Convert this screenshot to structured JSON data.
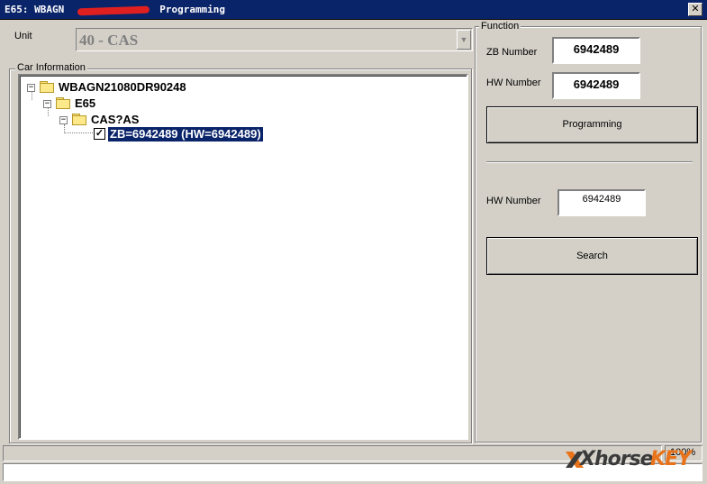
{
  "window": {
    "title_prefix": "E65: WBAGN",
    "title_suffix": "Programming",
    "close_glyph": "✕"
  },
  "unit": {
    "label": "Unit",
    "selected": "40 - CAS",
    "arrow_glyph": "▼"
  },
  "car_info": {
    "legend": "Car Information",
    "tree": [
      {
        "label": "WBAGN21080DR90248",
        "expander": "−"
      },
      {
        "label": "E65",
        "expander": "−"
      },
      {
        "label": "CAS?AS",
        "expander": "−"
      },
      {
        "label": "ZB=6942489 (HW=6942489)",
        "checked": "✓"
      }
    ]
  },
  "function": {
    "legend": "Function",
    "zb_label": "ZB Number",
    "zb_value": "6942489",
    "hw_label": "HW Number",
    "hw_value": "6942489",
    "programming_button": "Programming",
    "hw_search_label": "HW Number",
    "hw_search_value": "6942489",
    "search_button": "Search"
  },
  "status": {
    "progress": "100%"
  },
  "watermark": {
    "brand_a": "Xhorse",
    "brand_b": "KEY",
    "colors": {
      "dark": "#3a3a3a",
      "orange": "#e8731a"
    }
  }
}
